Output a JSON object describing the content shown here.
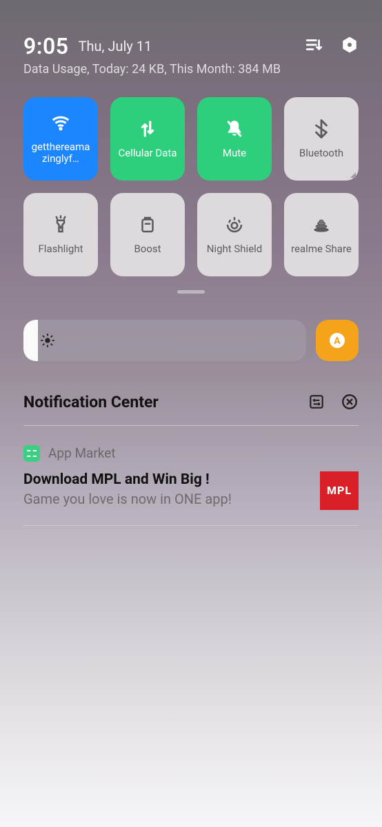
{
  "header": {
    "time": "9:05",
    "date": "Thu, July 11",
    "data_usage": "Data Usage, Today: 24 KB, This Month: 384 MB"
  },
  "tiles": {
    "wifi": "getthereamazinglyf…",
    "cellular": "Cellular Data",
    "mute": "Mute",
    "bluetooth": "Bluetooth",
    "flashlight": "Flashlight",
    "boost": "Boost",
    "nightshield": "Night Shield",
    "realmeshare": "realme Share"
  },
  "brightness": {
    "auto_label": "A"
  },
  "notif_center": {
    "title": "Notification Center"
  },
  "notification": {
    "app": "App Market",
    "title": "Download MPL and Win Big !",
    "subtitle": "Game you love is now in ONE app!",
    "thumb": "MPL"
  }
}
